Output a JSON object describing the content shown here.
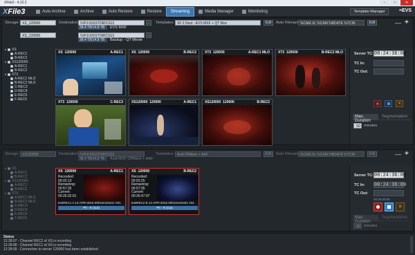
{
  "titlebar": {
    "title": "XFile3 - 4.12.2",
    "min": "–",
    "max": "□",
    "close": "✕"
  },
  "menu": {
    "logo_x": "X",
    "logo_rest": "File3",
    "tabs": [
      {
        "label": "Auto Archive"
      },
      {
        "label": "Archive"
      },
      {
        "label": "Auto Restore"
      },
      {
        "label": "Restore"
      },
      {
        "label": "Streaming"
      },
      {
        "label": "Media Manager"
      },
      {
        "label": "Monitoring"
      }
    ],
    "template_manager": "Template Manager",
    "brand": "≡EVS"
  },
  "top": {
    "storage_label": "Storage:",
    "storage_value": "XS_120000",
    "storage2_value": "XS_120000",
    "dest_label": "Destinations:",
    "dest1_path": "\\\\VF1\\XS\\STOR\\CS13",
    "dest1_size": "38.4 TB/14.8 TB",
    "dest1_name": "EVS MXF",
    "dest2_path": "\\\\VF1\\XS\\STOR\\CS13",
    "dest2_size": "38.4 TB/14.8 TB",
    "dest2_name": "Backup - QT Movie",
    "templates_label": "Templates:",
    "template_value": "XF 2 Dest - EVS MXF + QT Mov",
    "edit": "Edit",
    "autofilename_label": "Auto Filename:",
    "autofilename_value": "%CAM.XL %CAM %BDATE %TCIN",
    "browse": "...",
    "tree": [
      {
        "label": "XS",
        "level": 0
      },
      {
        "label": "A-REC1",
        "level": 1
      },
      {
        "label": "B-REC2",
        "level": 1
      },
      {
        "label": "XS120000",
        "level": 0
      },
      {
        "label": "A-REC1",
        "level": 1
      },
      {
        "label": "B-REC2",
        "level": 1
      },
      {
        "label": "XT3",
        "level": 0
      },
      {
        "label": "A-REC1 MLO",
        "level": 1
      },
      {
        "label": "B-REC2 MLO",
        "level": 1
      },
      {
        "label": "C-REC3",
        "level": 1
      },
      {
        "label": "D-REC4",
        "level": 1
      },
      {
        "label": "E-REC5",
        "level": 1
      },
      {
        "label": "F-REC6",
        "level": 1
      }
    ],
    "tiles": [
      {
        "server": "XS",
        "id": "120000",
        "rec": "A-REC1"
      },
      {
        "server": "XS",
        "id": "120000",
        "rec": "B-REC2"
      },
      {
        "server": "XT3",
        "id": "120500",
        "rec": "A-REC1 MLO"
      },
      {
        "server": "XT3",
        "id": "120500",
        "rec": "B-REC2 MLO"
      },
      {
        "server": "XT3",
        "id": "120500",
        "rec": "C-REC3"
      },
      {
        "server": "XS120000",
        "id": "120000",
        "rec": "A-REC1"
      },
      {
        "server": "XS120000",
        "id": "120000",
        "rec": "B-REC2"
      }
    ],
    "server_tc_label": "Server TC:",
    "server_tc": "00:24:36:08",
    "tc_in_label": "TC In:",
    "tc_out_label": "TC Out:",
    "max_duration_tab": "Max. Duration",
    "segmentation_tab": "Segmentation",
    "minutes_value": "60",
    "minutes_label": "minutes"
  },
  "bottom": {
    "storage_label": "Storage:",
    "storage_value": "XS120000",
    "dest_label": "Destinations:",
    "dest1_path": "\\\\VF1\\XS\\STOR\\CS13",
    "dest1_size": "38.4 TB/14.8 TB",
    "dest1_name": "Avid MXF OPAtom + AAF",
    "templates_label": "Templates:",
    "template_value": "Avid OPAtom + AAF",
    "edit": "Edit",
    "autofilename_label": "Auto Filename:",
    "autofilename_value": "%CAM.XL %CAM %BDATE %TCIN",
    "tree": [
      {
        "label": "XS",
        "level": 0
      },
      {
        "label": "A-REC1",
        "level": 1
      },
      {
        "label": "B-REC2",
        "level": 1
      },
      {
        "label": "XS120000",
        "level": 0
      },
      {
        "label": "A-REC1",
        "level": 1
      },
      {
        "label": "B-REC2",
        "level": 1
      },
      {
        "label": "XT3",
        "level": 0
      },
      {
        "label": "A-REC1 MLO",
        "level": 1
      },
      {
        "label": "B-REC2 MLO",
        "level": 1
      },
      {
        "label": "C-REC3",
        "level": 1
      },
      {
        "label": "D-REC4",
        "level": 1
      },
      {
        "label": "E-REC5",
        "level": 1
      },
      {
        "label": "F-REC6",
        "level": 1
      }
    ],
    "clips": [
      {
        "server": "XS",
        "id": "120000",
        "rec": "A-REC1",
        "recorded_label": "Recorded:",
        "recorded": "00:02:13",
        "remaining_label": "Remaining:",
        "remaining": "00:57:35",
        "current_label": "Current:",
        "current": "00:26:32:01",
        "filename": "testREC1 A 14-APR-2016 00h24m22s01 V01",
        "format": "P5 - 8 (11a)"
      },
      {
        "server": "XS",
        "id": "120000",
        "rec": "B-REC2",
        "recorded_label": "Recorded:",
        "recorded": "00:02:25",
        "remaining_label": "Remaining:",
        "remaining": "00:57:35",
        "current_label": "Current:",
        "current": "00:26:47:07",
        "filename": "testREC2 B 14-APR-2016 00h24m22s01 V01",
        "format": "P5 - 8 (11a)"
      }
    ],
    "server_tc_label": "Server TC:",
    "server_tc": "00:24:36:09",
    "tc_in_label": "TC In:",
    "tc_in": "00:24:36:09",
    "tc_out_label": "TC Out:",
    "duration_small": "00:00:00:00",
    "max_duration_tab": "Max. Duration",
    "segmentation_tab": "Segmentation",
    "minutes_value": "60",
    "minutes_label": "minutes"
  },
  "status": {
    "title": "Status",
    "lines": [
      "12:28:07 - Channel REC2 of XS  is recording",
      "12:28:08 - Channel REC1 of XS  is recording",
      "12:28:09 - Connection to server 120000 has been established"
    ]
  }
}
